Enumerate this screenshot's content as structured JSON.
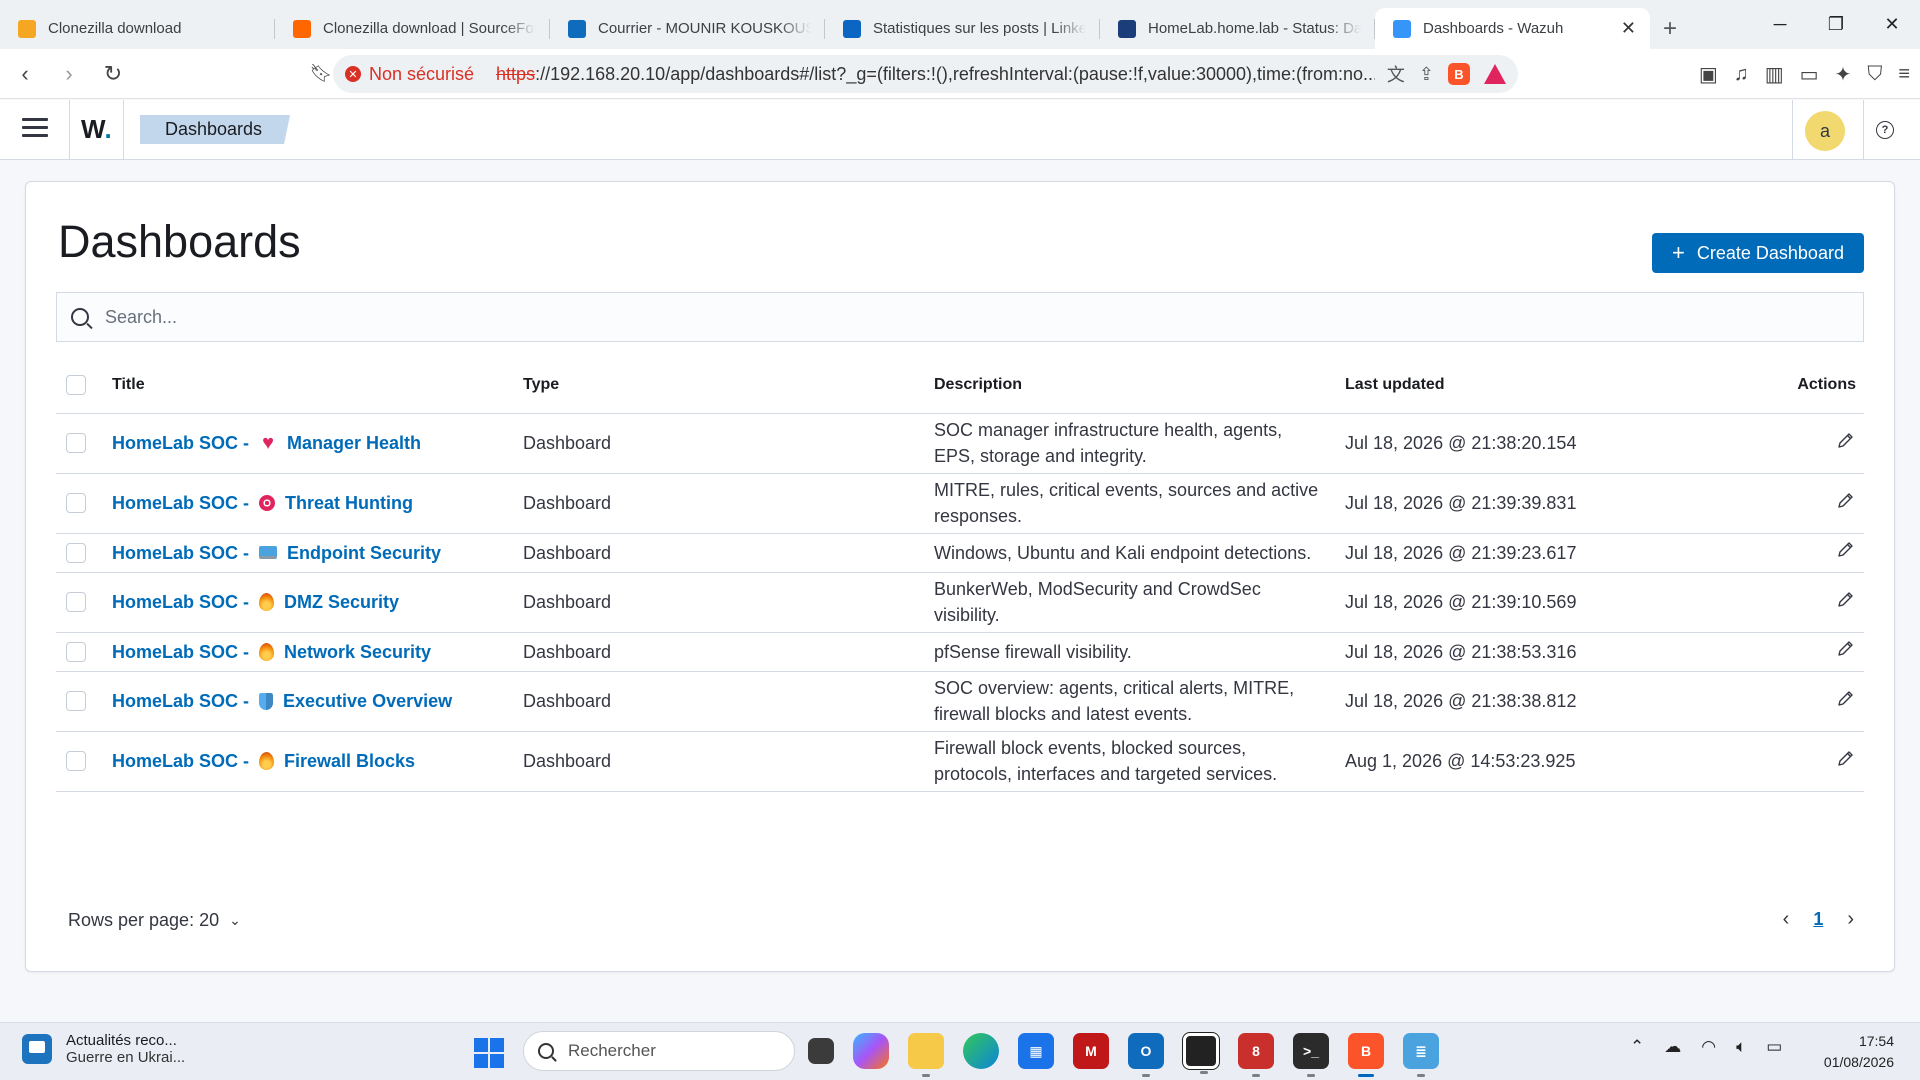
{
  "browser": {
    "tabs": [
      {
        "title": "Clonezilla download",
        "favicon": "clonezilla-icon",
        "color": "#f5a623",
        "active": false
      },
      {
        "title": "Clonezilla download | SourceForge",
        "favicon": "sourceforge-icon",
        "color": "#ff6600",
        "active": false
      },
      {
        "title": "Courrier - MOUNIR KOUSKOUS - Outlook",
        "favicon": "outlook-icon",
        "color": "#0f6cbd",
        "active": false
      },
      {
        "title": "Statistiques sur les posts | LinkedIn",
        "favicon": "linkedin-icon",
        "color": "#0a66c2",
        "active": false
      },
      {
        "title": "HomeLab.home.lab - Status: Dashboard",
        "favicon": "pfsense-icon",
        "color": "#1b3d7a",
        "active": false
      },
      {
        "title": "Dashboards - Wazuh",
        "favicon": "wazuh-icon",
        "color": "#3595f9",
        "active": true
      }
    ],
    "security_label": "Non sécurisé",
    "url_scheme": "https",
    "url_rest": "://192.168.20.10/app/dashboards#/list?_g=(filters:!(),refreshInterval:(pause:!f,value:30000),time:(from:no..."
  },
  "app": {
    "logo": "W",
    "breadcrumb": "Dashboards",
    "avatar_letter": "a"
  },
  "page": {
    "title": "Dashboards",
    "create_button": "Create Dashboard",
    "search_placeholder": "Search...",
    "columns": {
      "title": "Title",
      "type": "Type",
      "description": "Description",
      "updated": "Last updated",
      "actions": "Actions"
    },
    "rows": [
      {
        "prefix": "HomeLab SOC -",
        "emoji": "heart-icon",
        "name": "Manager Health",
        "type": "Dashboard",
        "description": "SOC manager infrastructure health, agents, EPS, storage and integrity.",
        "updated": "Jul 18, 2026 @ 21:38:20.154"
      },
      {
        "prefix": "HomeLab SOC -",
        "emoji": "target-icon",
        "name": "Threat Hunting",
        "type": "Dashboard",
        "description": "MITRE, rules, critical events, sources and active responses.",
        "updated": "Jul 18, 2026 @ 21:39:39.831"
      },
      {
        "prefix": "HomeLab SOC -",
        "emoji": "laptop-icon",
        "name": "Endpoint Security",
        "type": "Dashboard",
        "description": "Windows, Ubuntu and Kali endpoint detections.",
        "updated": "Jul 18, 2026 @ 21:39:23.617"
      },
      {
        "prefix": "HomeLab SOC -",
        "emoji": "fire-icon",
        "name": "DMZ Security",
        "type": "Dashboard",
        "description": "BunkerWeb, ModSecurity and CrowdSec visibility.",
        "updated": "Jul 18, 2026 @ 21:39:10.569"
      },
      {
        "prefix": "HomeLab SOC -",
        "emoji": "fire-icon",
        "name": "Network Security",
        "type": "Dashboard",
        "description": "pfSense firewall visibility.",
        "updated": "Jul 18, 2026 @ 21:38:53.316"
      },
      {
        "prefix": "HomeLab SOC -",
        "emoji": "shield-icon",
        "name": "Executive Overview",
        "type": "Dashboard",
        "description": "SOC overview: agents, critical alerts, MITRE, firewall blocks and latest events.",
        "updated": "Jul 18, 2026 @ 21:38:38.812"
      },
      {
        "prefix": "HomeLab SOC -",
        "emoji": "fire-icon",
        "name": "Firewall Blocks",
        "type": "Dashboard",
        "description": "Firewall block events, blocked sources, protocols, interfaces and targeted services.",
        "updated": "Aug 1, 2026 @ 14:53:23.925"
      }
    ],
    "rows_per_page": "Rows per page: 20",
    "current_page": "1"
  },
  "taskbar": {
    "news_title": "Actualités reco...",
    "news_sub": "Guerre en Ukrai...",
    "search_placeholder": "Rechercher",
    "time": "17:54",
    "date": "01/08/2026"
  },
  "colors": {
    "link": "#006bb8",
    "primary_button": "#006bb8",
    "breadcrumb_bg": "#c3d7ec",
    "avatar_bg": "#f1d86f"
  }
}
